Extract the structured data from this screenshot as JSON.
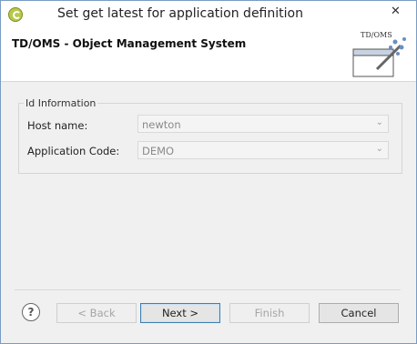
{
  "window": {
    "title": "Set get latest for application definition",
    "close_glyph": "✕"
  },
  "banner": {
    "title": "TD/OMS - Object Management System",
    "logo_text": "TD/OMS"
  },
  "group": {
    "legend": "Id Information",
    "fields": [
      {
        "label": "Host name:",
        "value": "newton"
      },
      {
        "label": "Application Code:",
        "value": "DEMO"
      }
    ]
  },
  "buttons": {
    "back": "< Back",
    "next": "Next >",
    "finish": "Finish",
    "cancel": "Cancel",
    "help": "?"
  },
  "icons": {
    "app": "app-logo-icon",
    "dropdown": "chevron-down-icon",
    "help": "help-icon",
    "banner": "wizard-banner-icon"
  },
  "colors": {
    "accent": "#3c7fb1",
    "window_border": "#7a9cc4"
  }
}
